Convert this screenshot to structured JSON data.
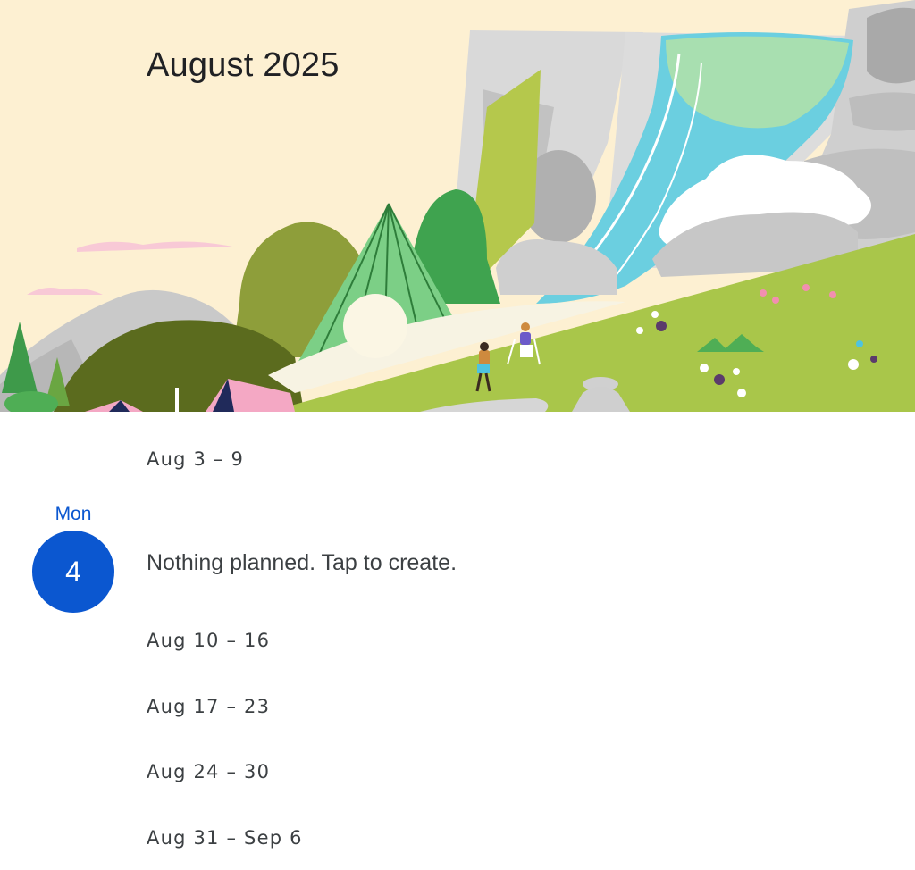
{
  "header": {
    "month_title": "August 2025"
  },
  "schedule": {
    "week_before": "Aug 3 – 9",
    "today": {
      "day_name": "Mon",
      "day_number": "4",
      "empty_message": "Nothing planned. Tap to create."
    },
    "weeks_after": [
      "Aug 10 – 16",
      "Aug 17 – 23",
      "Aug 24 – 30",
      "Aug 31 – Sep 6"
    ]
  },
  "colors": {
    "accent": "#0b57d0",
    "banner_background": "#fdf0d2",
    "text_primary": "#202124",
    "text_secondary": "#3c4043"
  },
  "illustration": {
    "subject": "mountain-waterfall-camping-scene"
  }
}
